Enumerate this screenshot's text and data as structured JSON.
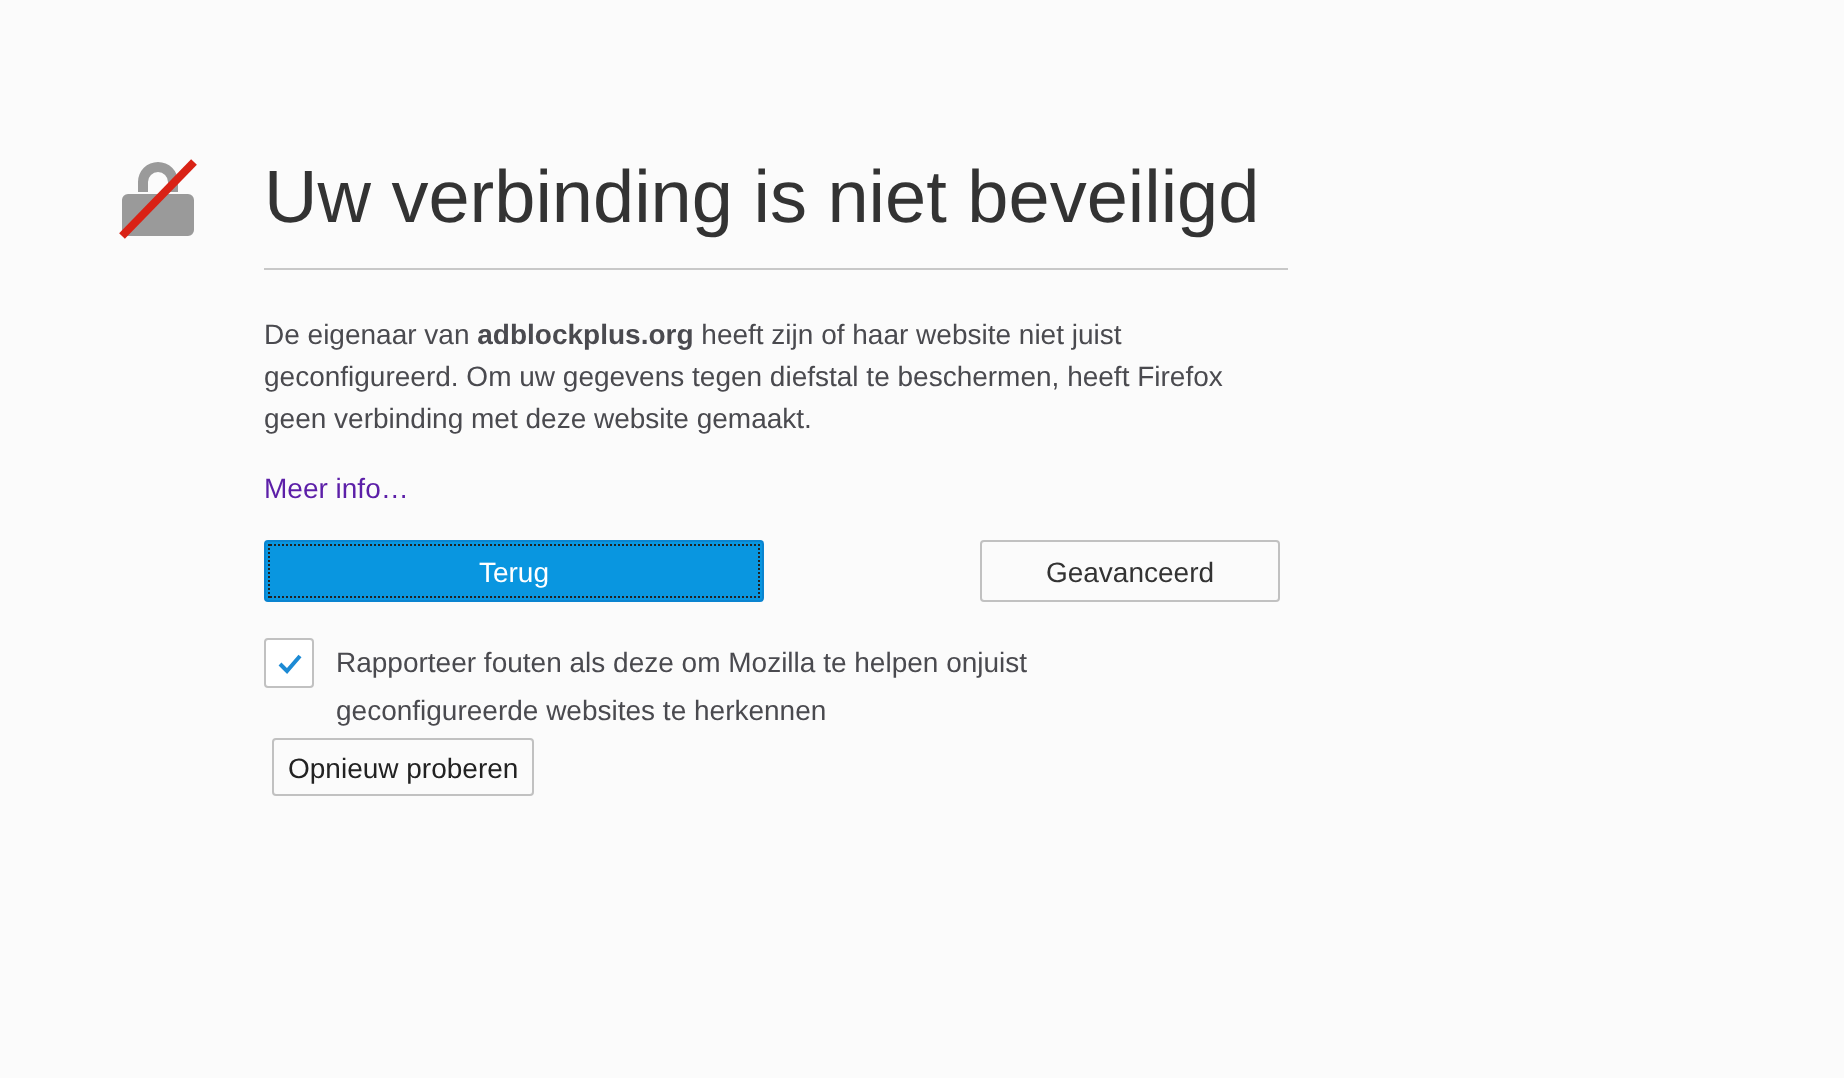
{
  "title": "Uw verbinding is niet beveiligd",
  "description": "De eigenaar van **adblockplus.org** heeft zijn of haar website niet juist geconfigureerd. Om uw gegevens tegen diefstal te beschermen, heeft Firefox geen verbinding met deze website gemaakt.",
  "more_info_link": "Meer info…",
  "buttons": [
    {
      "label": "Terug",
      "kind": "primary"
    },
    {
      "label": "Geavanceerd",
      "kind": "secondary"
    }
  ],
  "report": {
    "checked": true,
    "label": "Rapporteer fouten als deze om Mozilla te helpen onjuist geconfigureerde websites te herkennen"
  },
  "retry_button": "Opnieuw proberen"
}
